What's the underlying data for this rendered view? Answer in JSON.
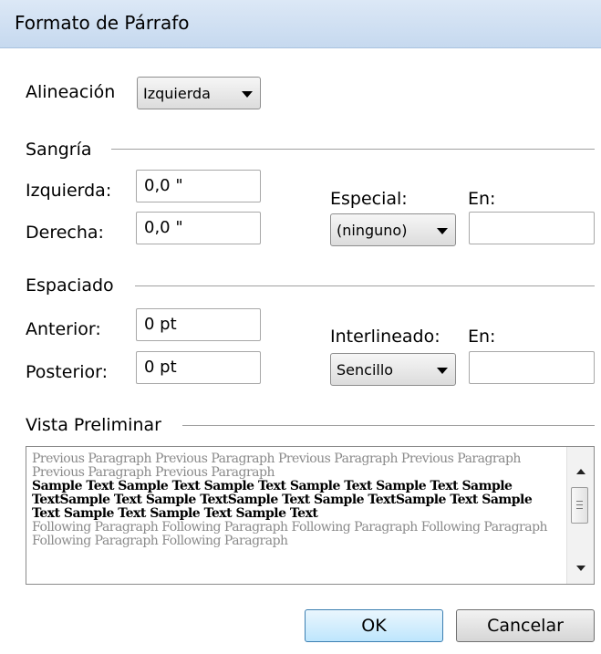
{
  "dialog": {
    "title": "Formato de Párrafo"
  },
  "alineacion": {
    "label": "Alineación",
    "value": "Izquierda"
  },
  "sangria": {
    "group_label": "Sangría",
    "izquierda_label": "Izquierda:",
    "izquierda_value": "0,0 \"",
    "derecha_label": "Derecha:",
    "derecha_value": "0,0 \"",
    "especial_label": "Especial:",
    "especial_value": "(ninguno)",
    "en_label": "En:",
    "en_value": ""
  },
  "espaciado": {
    "group_label": "Espaciado",
    "anterior_label": "Anterior:",
    "anterior_value": "0 pt",
    "posterior_label": "Posterior:",
    "posterior_value": "0 pt",
    "interlineado_label": "Interlineado:",
    "interlineado_value": "Sencillo",
    "en_label": "En:",
    "en_value": ""
  },
  "preview": {
    "group_label": "Vista Preliminar",
    "previous_text": "Previous Paragraph Previous Paragraph Previous Paragraph Previous Paragraph Previous Paragraph Previous Paragraph",
    "sample_text": "Sample Text Sample Text Sample Text Sample Text Sample Text Sample TextSample Text Sample TextSample Text Sample TextSample Text Sample Text Sample Text Sample Text Sample Text",
    "following_text": "Following Paragraph Following Paragraph Following Paragraph Following Paragraph Following Paragraph Following Paragraph"
  },
  "buttons": {
    "ok": "OK",
    "cancel": "Cancelar"
  }
}
